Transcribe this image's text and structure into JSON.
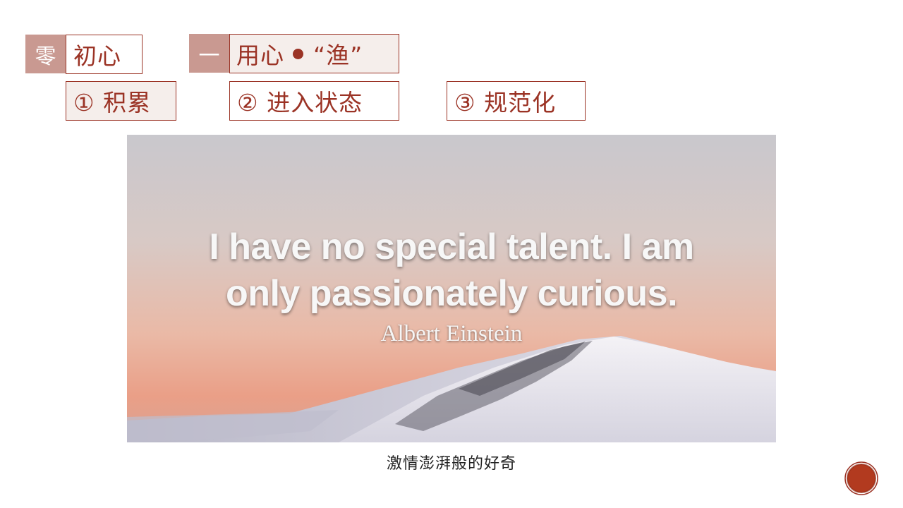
{
  "section_zero": {
    "number": "零",
    "label": "初心"
  },
  "section_one": {
    "number": "一",
    "label_main": "用心",
    "label_quote": "“渔”"
  },
  "steps": [
    {
      "label": "①  积累"
    },
    {
      "label": "②  进入状态"
    },
    {
      "label": "③  规范化"
    }
  ],
  "quote": {
    "line1": "I have no special talent. I am",
    "line2": "only passionately curious.",
    "author": "Albert Einstein"
  },
  "caption": "激情澎湃般的好奇",
  "colors": {
    "accent": "#9b3325",
    "muted_box": "#c99991",
    "tint": "#f5eeeb"
  },
  "icons": {
    "bullet": "bullet-dot-icon",
    "badge": "seal-badge-icon"
  }
}
